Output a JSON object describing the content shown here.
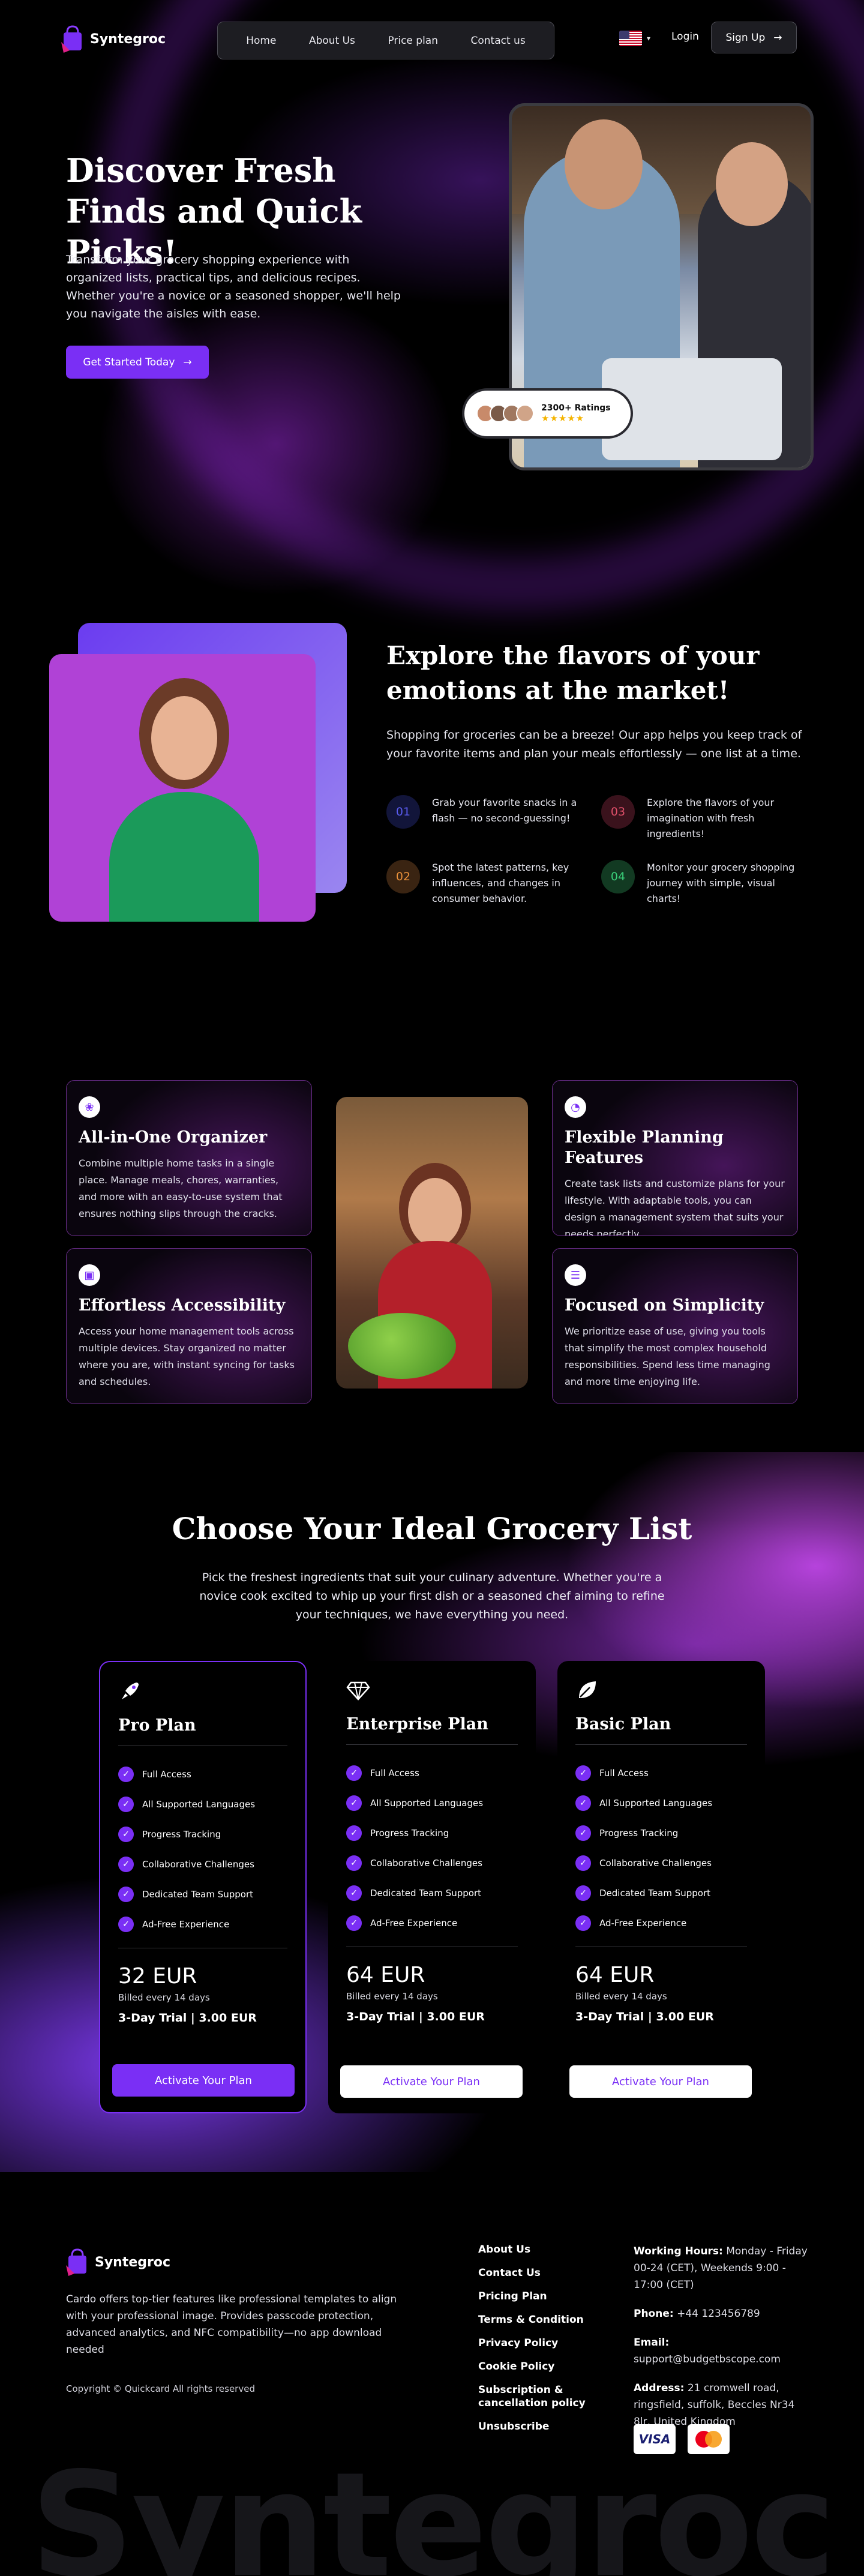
{
  "brand": {
    "name": "Syntegroc",
    "accent": "#7a2ff5"
  },
  "nav": {
    "items": [
      "Home",
      "About Us",
      "Price plan",
      "Contact us"
    ],
    "language_icon": "us-flag-icon",
    "login": "Login",
    "signup": "Sign Up"
  },
  "hero": {
    "title": "Discover Fresh Finds and Quick Picks!",
    "description": "Transform your grocery shopping experience with organized lists, practical tips, and delicious recipes. Whether you're a novice or a seasoned shopper, we'll help you navigate the aisles with ease.",
    "cta": "Get Started Today",
    "ratings_label": "2300+ Ratings",
    "stars": "★★★★★"
  },
  "explore": {
    "title": "Explore the flavors of your emotions at the market!",
    "description": "Shopping for groceries can be a breeze! Our app helps you keep track of your favorite items and plan your meals effortlessly — one list at a time.",
    "features": [
      {
        "num": "01",
        "text": "Grab your favorite snacks in a flash — no second-guessing!",
        "color": "#5a5cf0",
        "bg": "#12153a"
      },
      {
        "num": "03",
        "text": "Explore the flavors of your imagination with fresh ingredients!",
        "color": "#e0506a",
        "bg": "#3a121c"
      },
      {
        "num": "02",
        "text": "Spot the latest patterns, key influences, and changes in consumer behavior.",
        "color": "#e8903a",
        "bg": "#3a2412"
      },
      {
        "num": "04",
        "text": "Monitor your grocery shopping journey with simple, visual charts!",
        "color": "#3ad07a",
        "bg": "#123a22"
      }
    ]
  },
  "cards": [
    {
      "title": "All-in-One Organizer",
      "icon": "cluster-icon",
      "glyph": "❀",
      "desc": "Combine multiple home tasks in a single place. Manage meals, chores, warranties, and more with an easy-to-use system that ensures nothing slips through the cracks."
    },
    {
      "title": "Flexible Planning Features",
      "icon": "dial-icon",
      "glyph": "◔",
      "desc": "Create task lists and customize plans for your lifestyle. With adaptable tools, you can design a management system that suits your needs perfectly."
    },
    {
      "title": "Effortless Accessibility",
      "icon": "device-icon",
      "glyph": "▣",
      "desc": "Access your home management tools across multiple devices. Stay organized no matter where you are, with instant syncing for tasks and schedules."
    },
    {
      "title": "Focused on Simplicity",
      "icon": "list-icon",
      "glyph": "☰",
      "desc": "We prioritize ease of use, giving you tools that simplify the most complex household responsibilities. Spend less time managing and more time enjoying life."
    }
  ],
  "pricing": {
    "title": "Choose Your Ideal Grocery List",
    "description": "Pick the freshest ingredients that suit your culinary adventure. Whether you're a novice cook excited to whip up your first dish or a seasoned chef aiming to refine your techniques, we have everything you need.",
    "features": [
      "Full Access",
      "All Supported Languages",
      "Progress Tracking",
      "Collaborative Challenges",
      "Dedicated Team Support",
      "Ad-Free Experience"
    ],
    "plans": [
      {
        "name": "Pro Plan",
        "icon": "rocket-icon",
        "glyph": "🚀",
        "price": "32 EUR",
        "billed": "Billed every 14 days",
        "trial": "3-Day Trial | 3.00 EUR",
        "button": "Activate Your Plan"
      },
      {
        "name": "Enterprise Plan",
        "icon": "diamond-icon",
        "glyph": "◇",
        "price": "64 EUR",
        "billed": "Billed every 14 days",
        "trial": "3-Day Trial | 3.00 EUR",
        "button": "Activate Your Plan"
      },
      {
        "name": "Basic Plan",
        "icon": "leaf-icon",
        "glyph": "❦",
        "price": "64 EUR",
        "billed": "Billed every 14 days",
        "trial": "3-Day Trial | 3.00 EUR",
        "button": "Activate Your Plan"
      }
    ]
  },
  "footer": {
    "description": "Cardo offers top-tier features like professional templates to align with your professional image. Provides passcode protection, advanced analytics, and NFC compatibility—no app download needed",
    "copyright": "Copyright © Quickcard All rights reserved",
    "links": [
      "About Us",
      "Contact Us",
      "Pricing Plan",
      "Terms & Condition",
      "Privacy Policy",
      "Cookie Policy",
      "Subscription & cancellation policy",
      "Unsubscribe"
    ],
    "hours_label": "Working Hours:",
    "hours": "Monday - Friday 00-24 (CET), Weekends 9:00 - 17:00 (CET)",
    "phone_label": "Phone:",
    "phone": "+44 123456789",
    "email_label": "Email:",
    "email": "support@budgetbscope.com",
    "address_label": "Address:",
    "address": "21 cromwell road, ringsfield, suffolk, Beccles Nr34 8lr, United Kingdom",
    "payment": [
      "VISA",
      "mastercard-icon"
    ],
    "watermark": "Syntegroc"
  }
}
